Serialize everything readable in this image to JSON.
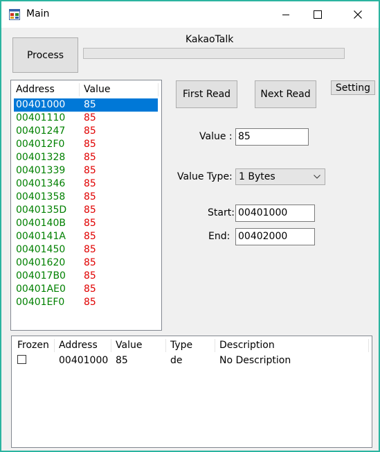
{
  "window": {
    "title": "Main"
  },
  "header": {
    "process_label": "Process",
    "progress_label": "KakaoTalk",
    "progress_value": 0
  },
  "buttons": {
    "first_read": "First Read",
    "next_read": "Next Read",
    "setting": "Setting"
  },
  "form": {
    "value_label": "Value :",
    "value": "85",
    "value_type_label": "Value Type:",
    "value_type": "1 Bytes",
    "start_label": "Start:",
    "start": "00401000",
    "end_label": "End:",
    "end": "00402000"
  },
  "results": {
    "columns": [
      "Address",
      "Value"
    ],
    "rows": [
      {
        "address": "00401000",
        "value": "85",
        "selected": true
      },
      {
        "address": "00401110",
        "value": "85"
      },
      {
        "address": "00401247",
        "value": "85"
      },
      {
        "address": "004012F0",
        "value": "85"
      },
      {
        "address": "00401328",
        "value": "85"
      },
      {
        "address": "00401339",
        "value": "85"
      },
      {
        "address": "00401346",
        "value": "85"
      },
      {
        "address": "00401358",
        "value": "85"
      },
      {
        "address": "0040135D",
        "value": "85"
      },
      {
        "address": "0040140B",
        "value": "85"
      },
      {
        "address": "0040141A",
        "value": "85"
      },
      {
        "address": "00401450",
        "value": "85"
      },
      {
        "address": "00401620",
        "value": "85"
      },
      {
        "address": "004017B0",
        "value": "85"
      },
      {
        "address": "00401AE0",
        "value": "85"
      },
      {
        "address": "00401EF0",
        "value": "85"
      }
    ]
  },
  "watchlist": {
    "columns": [
      "Frozen",
      "Address",
      "Value",
      "Type",
      "Description"
    ],
    "rows": [
      {
        "frozen": false,
        "address": "00401000",
        "value": "85",
        "type": "de",
        "description": "No Description"
      }
    ]
  }
}
